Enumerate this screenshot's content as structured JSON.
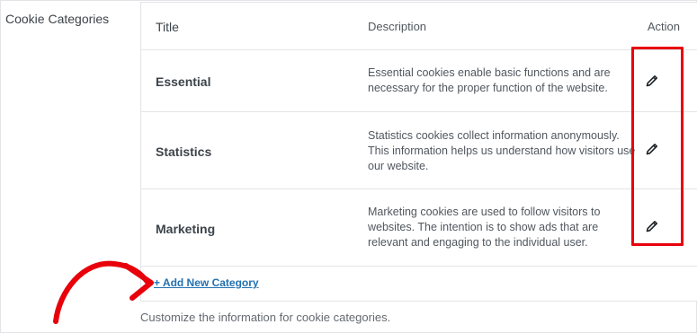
{
  "section": {
    "label": "Cookie Categories",
    "help_text": "Customize the information for cookie categories."
  },
  "table": {
    "headers": {
      "title": "Title",
      "description": "Description",
      "action": "Action"
    },
    "rows": [
      {
        "title": "Essential",
        "desc_lines": [
          "Essential cookies enable basic functions and are",
          "necessary for the proper function of the website."
        ],
        "action_icon": "pencil-icon"
      },
      {
        "title": "Statistics",
        "desc_lines": [
          "Statistics cookies collect information anonymously.",
          "This information helps us understand how visitors use",
          "our website."
        ],
        "action_icon": "pencil-icon"
      },
      {
        "title": "Marketing",
        "desc_lines": [
          "Marketing cookies are used to follow visitors to",
          "websites. The intention is to show ads that are",
          "relevant and engaging to the individual user."
        ],
        "action_icon": "pencil-icon"
      }
    ]
  },
  "add_category": {
    "label": "+ Add New Category"
  },
  "colors": {
    "annotation": "#e8000b",
    "link": "#2271b1"
  }
}
